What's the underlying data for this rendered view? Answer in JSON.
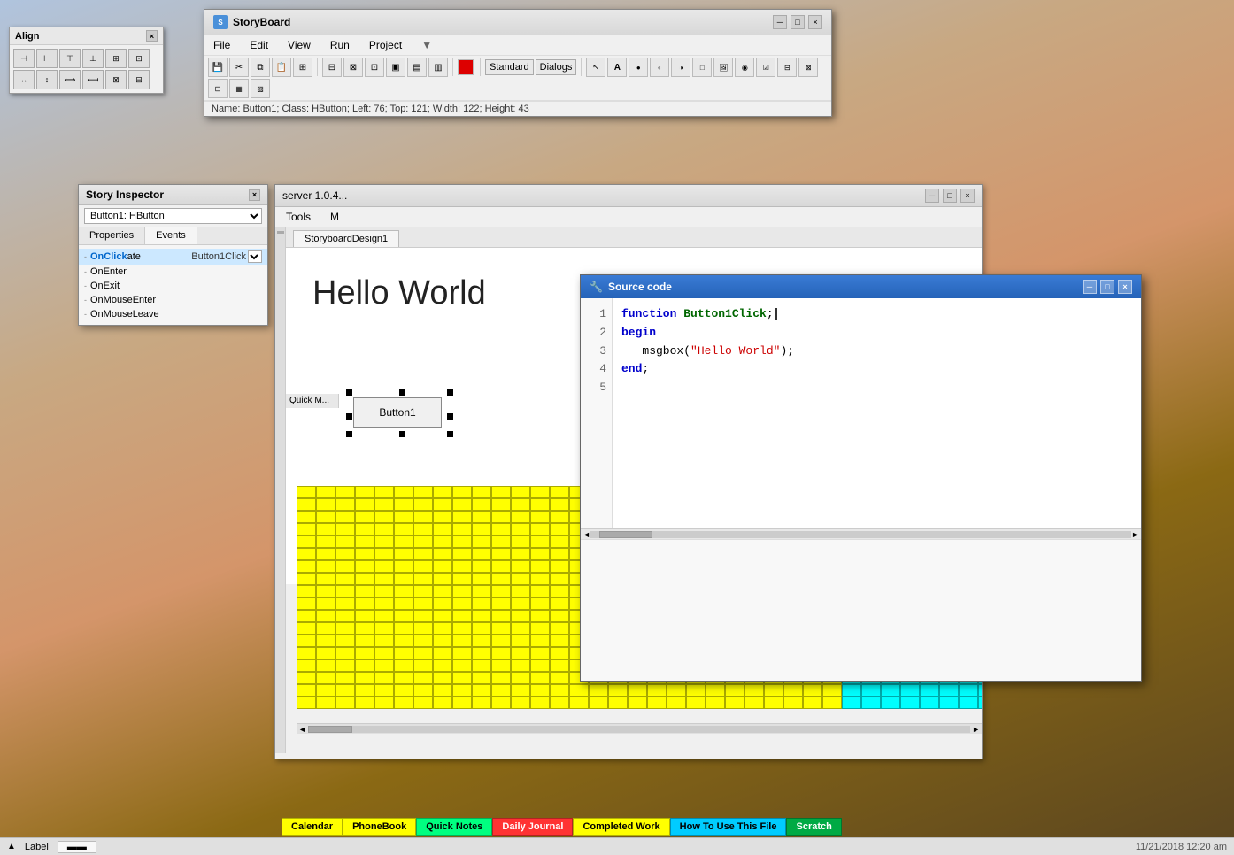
{
  "desktop": {
    "bg": "linear-gradient desktop"
  },
  "align_window": {
    "title": "Align",
    "close_label": "×",
    "buttons": [
      "↤",
      "⇤",
      "⇥",
      "⇤",
      "↦",
      "⊡",
      "↥",
      "⇡",
      "⇣",
      "⇡",
      "↧",
      "⊟"
    ]
  },
  "storyboard_window": {
    "title": "StoryBoard",
    "menu_items": [
      "File",
      "Edit",
      "View",
      "Run",
      "Project"
    ],
    "dropdown_label": "▼",
    "toolbar_icons": [
      "✂",
      "⧉",
      "⧈",
      "⧊",
      "⊞",
      "⊟",
      "⊠",
      "⊡",
      "▤",
      "▥",
      "▦",
      "▧",
      "⊏",
      "⊐",
      "⊑",
      "⊒",
      "●",
      "▣",
      "▤",
      "▥",
      "▦",
      "▧"
    ],
    "tabs_label": [
      "Standard",
      "Dialogs"
    ],
    "statusbar_text": "Name: Button1; Class: HButton; Left: 76; Top: 121; Width: 122; Height: 43"
  },
  "inspector_window": {
    "title": "Story Inspector",
    "close_label": "×",
    "selected_item": "Button1: HButton",
    "tabs": [
      "Properties",
      "Events"
    ],
    "events": [
      {
        "name": "OnClick",
        "handler": "Button1Click",
        "selected": true
      },
      {
        "name": "OnEnter",
        "handler": "",
        "selected": false
      },
      {
        "name": "OnExit",
        "handler": "",
        "selected": false
      },
      {
        "name": "OnMouseEnter",
        "handler": "",
        "selected": false
      },
      {
        "name": "OnMouseLeave",
        "handler": "",
        "selected": false
      }
    ]
  },
  "server_window": {
    "title": "server 1.0.4...",
    "menu_items": [
      "Tools",
      "M"
    ]
  },
  "design_canvas": {
    "tab_label": "StoryboardDesign1",
    "hello_world": "Hello World",
    "button1_label": "Button1"
  },
  "source_window": {
    "title": "Source code",
    "icon": "🔧",
    "minimize_label": "─",
    "maximize_label": "□",
    "close_label": "×",
    "line_numbers": [
      "1",
      "2",
      "3",
      "4",
      "5"
    ],
    "code_lines": [
      "function Button1Click;",
      "begin",
      "   msgbox(\"Hello World\");",
      "end;",
      ""
    ]
  },
  "bottom_tabs": [
    {
      "label": "Calendar",
      "color": "#ffff00"
    },
    {
      "label": "PhoneBook",
      "color": "#ffff00"
    },
    {
      "label": "Quick Notes",
      "color": "#00ff00"
    },
    {
      "label": "Daily Journal",
      "color": "#ff0000"
    },
    {
      "label": "Completed Work",
      "color": "#ffff00"
    },
    {
      "label": "How To Use This File",
      "color": "#00ccff"
    },
    {
      "label": "Scratch",
      "color": "#00aa00"
    }
  ],
  "statusbar": {
    "label_text": "Label",
    "datetime": "11/21/2018 12:20 am"
  }
}
